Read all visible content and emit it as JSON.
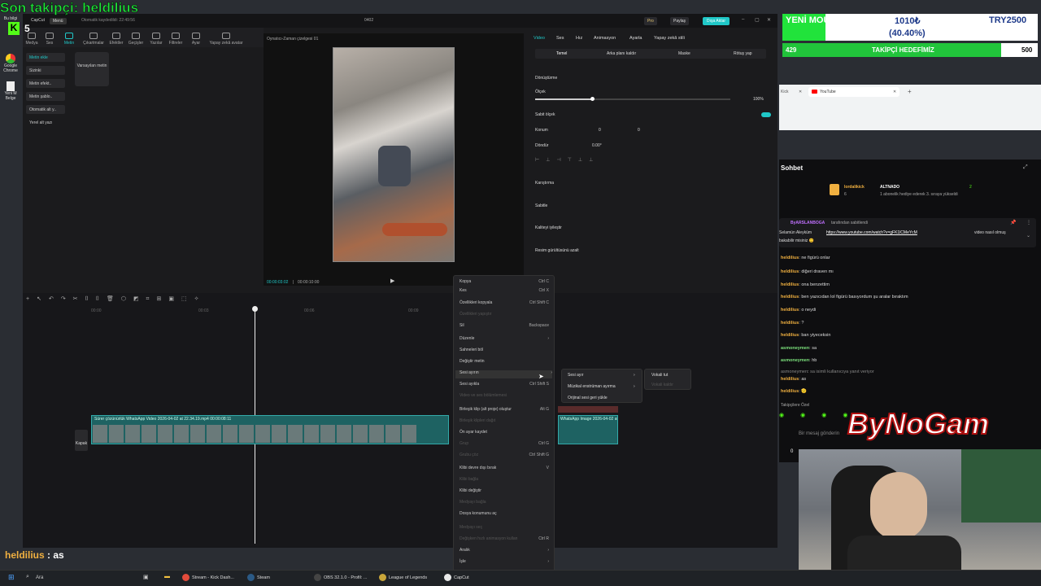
{
  "overlay": {
    "last_follower": "Son takipçi: heldilius",
    "kick_count": "5",
    "mouse_goal": {
      "label": "YENİ MOUSE",
      "current": "1010₺",
      "percent": "(40.40%)",
      "target": "TRY2500",
      "progress": 0.404
    },
    "follower_goal": {
      "current": "429",
      "label": "TAKİPÇİ HEDEFİMİZ",
      "target": "500",
      "progress": 0.858
    },
    "chat_echo_user": "heldilius",
    "chat_echo_sep": " : ",
    "chat_echo_msg": "as",
    "logo": "ByNoGam"
  },
  "desktop": {
    "icons": [
      "Bu bilgi",
      "Google Chrome",
      "Yeni M Belge"
    ]
  },
  "capcut": {
    "app": "CapCut",
    "autosave": "Otomatik kaydedildi: 22:49:56",
    "menu": "Menü",
    "project": "0402",
    "pro": "Pro",
    "share": "Paylaş",
    "export": "Dışa Aktar",
    "toolbar": [
      "Medya",
      "Ses",
      "Metin",
      "Çıkartmalar",
      "Efektler",
      "Geçişler",
      "Yazılar",
      "Filtreler",
      "Ayar",
      "Yapay zekâ avatar"
    ],
    "text_sidebar": [
      "Metin ekle",
      "Sizinki",
      "Metin efekt..",
      "Metin şablo..",
      "Otomatik alt y..",
      "Yerel alt yazı"
    ],
    "default_text": "Varsayılan metin",
    "player_title": "Oynatıcı-Zaman çizelgesi 01",
    "time_current": "00:00:03:02",
    "time_total": "00:00:10:00",
    "prop_tabs": [
      "Video",
      "Ses",
      "Hız",
      "Animasyon",
      "Ayarla",
      "Yapay zekâ stili"
    ],
    "sub_tabs": [
      "Temel",
      "Arka planı kaldır",
      "Maske",
      "Rötuş yap"
    ],
    "transform": "Dönüştürme",
    "scale_label": "Ölçek",
    "scale_value": "100%",
    "uniform_scale": "Sabit ölçek",
    "position_label": "Konum",
    "pos_x": "0",
    "pos_y": "0",
    "rotate_label": "Döndür",
    "rotate_value": "0.00°",
    "blend": "Karıştırma",
    "stabilize": "Sabitle",
    "enhance": "Kaliteyi iyileştir",
    "denoise": "Resim gürültüsünü azalt",
    "ruler": [
      "00:00",
      "00:03",
      "00:06",
      "00:09"
    ],
    "clip_label": "Sürer çözünürlük  WhatsApp Video 2026-04-02 at 22.34.19.mp4  00:00:08:11",
    "clip2_label": "WhatsApp Image 2026-04-02 at 22",
    "cover": "Kapak"
  },
  "context_menu": {
    "items": [
      {
        "label": "Kopya",
        "kb": "Ctrl C",
        "dis": false
      },
      {
        "label": "Kes",
        "kb": "Ctrl X",
        "dis": false
      },
      {
        "label": "Özellikleri kopyala",
        "kb": "Ctrl Shift C",
        "dis": false
      },
      {
        "label": "Özellikleri yapıştır",
        "kb": "",
        "dis": true
      },
      {
        "label": "Sil",
        "kb": "Backspace",
        "dis": false
      },
      {
        "label": "Düzenle",
        "kb": "›",
        "dis": false
      },
      {
        "label": "Sahneleri böl",
        "kb": "",
        "dis": false
      },
      {
        "label": "Değiştir metin",
        "kb": "",
        "dis": false
      },
      {
        "label": "Sesi ayırın",
        "kb": "›",
        "dis": false
      },
      {
        "label": "Sesi ayıkla",
        "kb": "Ctrl Shift S",
        "dis": false
      },
      {
        "label": "Video ve ses bölümlemesi",
        "kb": "",
        "dis": true
      },
      {
        "label": "Birleşik klip (alt proje) oluştur",
        "kb": "Alt G",
        "dis": false
      },
      {
        "label": "Birleşik klipleri dağıt",
        "kb": "",
        "dis": true
      },
      {
        "label": "Ön ayar kaydet",
        "kb": "",
        "dis": false
      },
      {
        "label": "Grup",
        "kb": "Ctrl G",
        "dis": true
      },
      {
        "label": "Grubu çöz",
        "kb": "Ctrl Shift G",
        "dis": true
      },
      {
        "label": "Klibi devre dışı bırak",
        "kb": "V",
        "dis": false
      },
      {
        "label": "Klibi bağla",
        "kb": "",
        "dis": true
      },
      {
        "label": "Klibi değiştir",
        "kb": "",
        "dis": false
      },
      {
        "label": "Medyayı bağla",
        "kb": "",
        "dis": true
      },
      {
        "label": "Dosya konumunu aç",
        "kb": "",
        "dis": false
      },
      {
        "label": "Medyayı seç",
        "kb": "",
        "dis": true
      },
      {
        "label": "Değişken hızlı animasyon kullan",
        "kb": "Ctrl R",
        "dis": true
      },
      {
        "label": "Aralık",
        "kb": "›",
        "dis": false
      },
      {
        "label": "İşle",
        "kb": "›",
        "dis": false
      }
    ],
    "sub1": [
      "Sesi ayır",
      "Müzikal enstrüman ayırma",
      "Orijinal sesi geri yükle"
    ],
    "sub2": [
      "Vokali tut",
      "Vokali kaldır"
    ]
  },
  "browser": {
    "tab1": "YouTube",
    "tab0": "Kick"
  },
  "chat": {
    "title": "Sohbet",
    "sub_user": "lordalikick",
    "sub_badge": "ALTNADO",
    "sub_count": "2",
    "sub_msg": "1 abonelik hediye ederek 3. sıraya yükseldi",
    "sub_small": "6",
    "pinned_by": "ByARSLANBOGA",
    "pinned_suffix": "tarafından sabitlendi",
    "pinned_msg": "Selamün Aleyküm",
    "pinned_link": "https://www.youtube.com/watch?v=gFK1lCMeYcM",
    "pinned_msg2": "video nasıl olmuş",
    "pinned_msg3": "bakabilir misiniz 😊",
    "lines": [
      {
        "u": "heldilius",
        "m": "ne figürü onlar",
        "c": "u"
      },
      {
        "u": "heldilius",
        "m": "diğeri draven mı",
        "c": "u"
      },
      {
        "u": "heldilius",
        "m": "ona benzettim",
        "c": "u"
      },
      {
        "u": "heldilius",
        "m": "ben yazıcıdan lol figürü basıyordum şu aralar bıraktım",
        "c": "u"
      },
      {
        "u": "heldilius",
        "m": "o neydi",
        "c": "u"
      },
      {
        "u": "heldilius",
        "m": "?",
        "c": "u"
      },
      {
        "u": "heldilius",
        "m": "ban yiyeceksin",
        "c": "u"
      },
      {
        "u": "asmoneymen",
        "m": "sa",
        "c": "u2"
      },
      {
        "u": "asmoneymen",
        "m": "hb",
        "c": "u2"
      },
      {
        "u": "asmoneymen",
        "m": "sa isimli kullanıcıya yanıt veriyor",
        "c": "reply"
      },
      {
        "u": "heldilius",
        "m": "as",
        "c": "u"
      },
      {
        "u": "heldilius",
        "m": "🫡",
        "c": "u"
      }
    ],
    "followers_only": "Takipçilere Özel",
    "send_placeholder": "Bir mesaj gönderin",
    "viewer_count": "0"
  },
  "taskbar": {
    "search": "Ara",
    "apps": [
      "Stream - Kick Dash...",
      "Steam",
      "OBS 32.1.0 - Profil: ...",
      "League of Legends",
      "CapCut"
    ],
    "colors": [
      "#e34b3b",
      "#2b5a86",
      "#444",
      "#c8a53a",
      "#e9e9e9"
    ]
  },
  "colors": {
    "accent": "#20c8c8",
    "goal_green": "#21e33b",
    "kick_green": "#53fc18"
  }
}
